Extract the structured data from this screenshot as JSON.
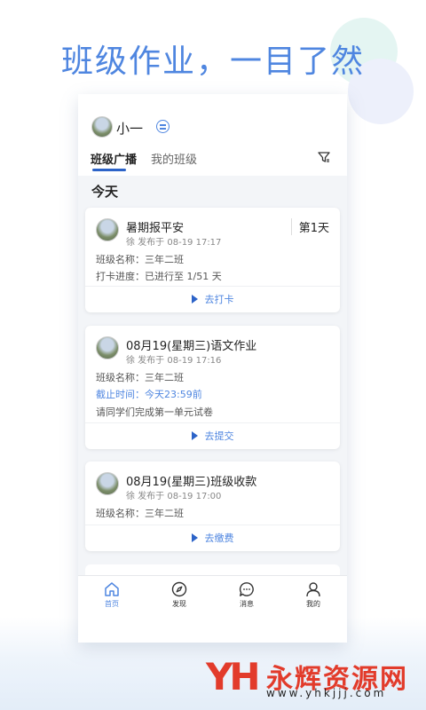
{
  "headline": "班级作业，一目了然",
  "header": {
    "user_name": "小一",
    "tabs": [
      {
        "label": "班级广播",
        "active": true
      },
      {
        "label": "我的班级",
        "active": false
      }
    ]
  },
  "section_title": "今天",
  "cards": [
    {
      "title": "暑期报平安",
      "meta": "徐 发布于 08-19 17:17",
      "badge": "第1天",
      "lines": [
        {
          "text": "班级名称：三年二班"
        },
        {
          "text": "打卡进度：已进行至 1/51 天"
        }
      ],
      "action": "去打卡"
    },
    {
      "title": "08月19(星期三)语文作业",
      "meta": "徐 发布于 08-19 17:16",
      "lines": [
        {
          "text": "班级名称：三年二班"
        },
        {
          "text": "截止时间：今天23:59前",
          "highlight": true
        },
        {
          "text": "请同学们完成第一单元试卷"
        }
      ],
      "action": "去提交"
    },
    {
      "title": "08月19(星期三)班级收款",
      "meta": "徐 发布于 08-19 17:00",
      "lines": [
        {
          "text": "班级名称：三年二班"
        }
      ],
      "action": "去缴费"
    }
  ],
  "nav": [
    {
      "label": "首页",
      "icon": "home-icon",
      "active": true
    },
    {
      "label": "发现",
      "icon": "compass-icon",
      "active": false
    },
    {
      "label": "消息",
      "icon": "message-icon",
      "active": false
    },
    {
      "label": "我的",
      "icon": "person-icon",
      "active": false
    }
  ],
  "watermark": {
    "logo": "YH",
    "name": "永辉资源网",
    "url": "www.yhkjjj.com"
  },
  "colors": {
    "accent": "#4f86e0",
    "tab_indicator": "#2c63c8",
    "watermark": "#e23b2b"
  }
}
